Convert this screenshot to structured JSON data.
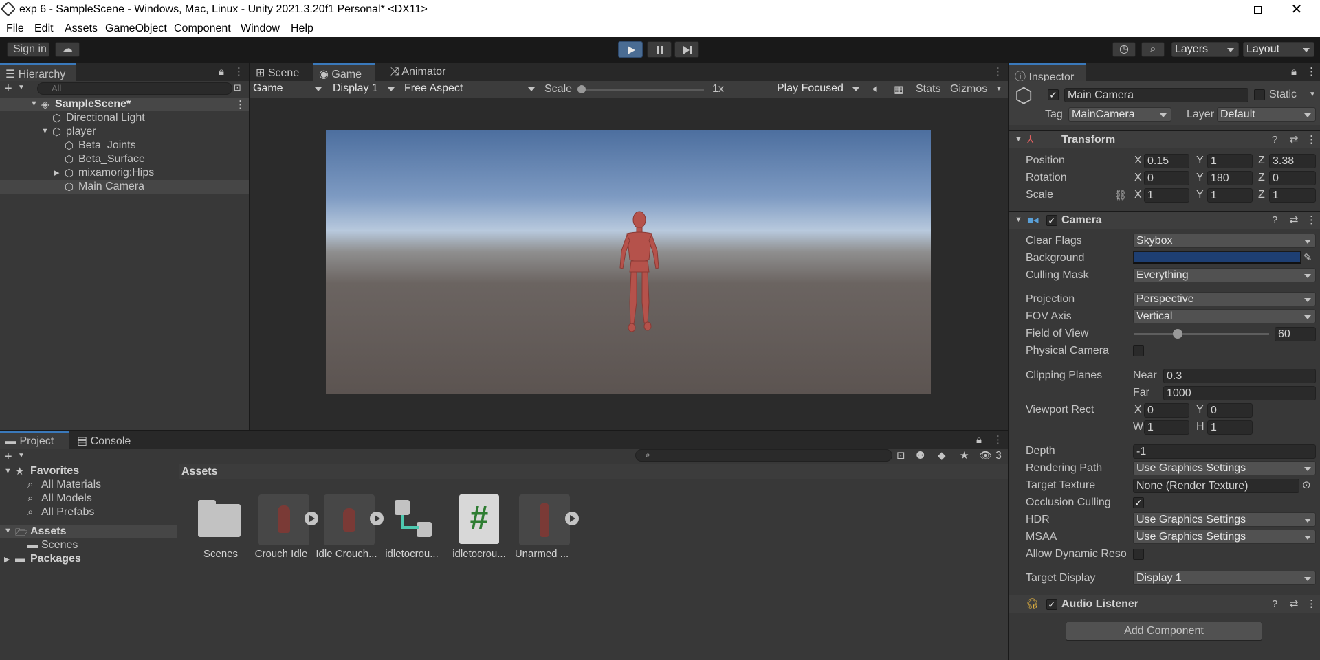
{
  "titlebar": {
    "title": "exp 6 - SampleScene - Windows, Mac, Linux - Unity 2021.3.20f1 Personal* <DX11>"
  },
  "menu": [
    "File",
    "Edit",
    "Assets",
    "GameObject",
    "Component",
    "Window",
    "Help"
  ],
  "toolbar": {
    "sign_in": "Sign in",
    "layers": "Layers",
    "layout": "Layout"
  },
  "hierarchy": {
    "tab": "Hierarchy",
    "search_placeholder": "All",
    "scene": "SampleScene*",
    "items": [
      "Directional Light",
      "player",
      "Beta_Joints",
      "Beta_Surface",
      "mixamorig:Hips",
      "Main Camera"
    ]
  },
  "game": {
    "tabs": [
      "Scene",
      "Game",
      "Animator"
    ],
    "mode": "Game",
    "display": "Display 1",
    "aspect": "Free Aspect",
    "scale_label": "Scale",
    "scale_value": "1x",
    "play_focused": "Play Focused",
    "stats": "Stats",
    "gizmos": "Gizmos"
  },
  "project": {
    "tabs": [
      "Project",
      "Console"
    ],
    "favorites": "Favorites",
    "fav_items": [
      "All Materials",
      "All Models",
      "All Prefabs"
    ],
    "assets_root": "Assets",
    "scenes": "Scenes",
    "packages": "Packages",
    "breadcrumb": "Assets",
    "hidden_count": "3",
    "assets": [
      "Scenes",
      "Crouch Idle",
      "Idle Crouch...",
      "idletocrou...",
      "idletocrou...",
      "Unarmed ..."
    ]
  },
  "inspector": {
    "tab": "Inspector",
    "object_name": "Main Camera",
    "static": "Static",
    "tag_label": "Tag",
    "tag": "MainCamera",
    "layer_label": "Layer",
    "layer": "Default",
    "transform": {
      "title": "Transform",
      "position_label": "Position",
      "position": [
        "0.15",
        "1",
        "3.38"
      ],
      "rotation_label": "Rotation",
      "rotation": [
        "0",
        "180",
        "0"
      ],
      "scale_label": "Scale",
      "scale": [
        "1",
        "1",
        "1"
      ]
    },
    "axis": [
      "X",
      "Y",
      "Z"
    ],
    "camera": {
      "title": "Camera",
      "clear_flags_label": "Clear Flags",
      "clear_flags": "Skybox",
      "background_label": "Background",
      "background_color": "#1e3f73",
      "culling_mask_label": "Culling Mask",
      "culling_mask": "Everything",
      "projection_label": "Projection",
      "projection": "Perspective",
      "fov_axis_label": "FOV Axis",
      "fov_axis": "Vertical",
      "fov_label": "Field of View",
      "fov": "60",
      "fov_fraction": 0.32,
      "physical_label": "Physical Camera",
      "clipping_label": "Clipping Planes",
      "near_label": "Near",
      "near": "0.3",
      "far_label": "Far",
      "far": "1000",
      "viewport_label": "Viewport Rect",
      "vx_label": "X",
      "vx": "0",
      "vy_label": "Y",
      "vy": "0",
      "vw_label": "W",
      "vw": "1",
      "vh_label": "H",
      "vh": "1",
      "depth_label": "Depth",
      "depth": "-1",
      "rendering_label": "Rendering Path",
      "rendering": "Use Graphics Settings",
      "target_texture_label": "Target Texture",
      "target_texture": "None (Render Texture)",
      "occlusion_label": "Occlusion Culling",
      "hdr_label": "HDR",
      "hdr": "Use Graphics Settings",
      "msaa_label": "MSAA",
      "msaa": "Use Graphics Settings",
      "dynres_label": "Allow Dynamic Resol",
      "target_display_label": "Target Display",
      "target_display": "Display 1"
    },
    "audio_listener": "Audio Listener",
    "add_component": "Add Component"
  },
  "colors": {
    "accent": "#3a79bb",
    "play_active": "#4a6c93",
    "character": "#b5524b"
  }
}
